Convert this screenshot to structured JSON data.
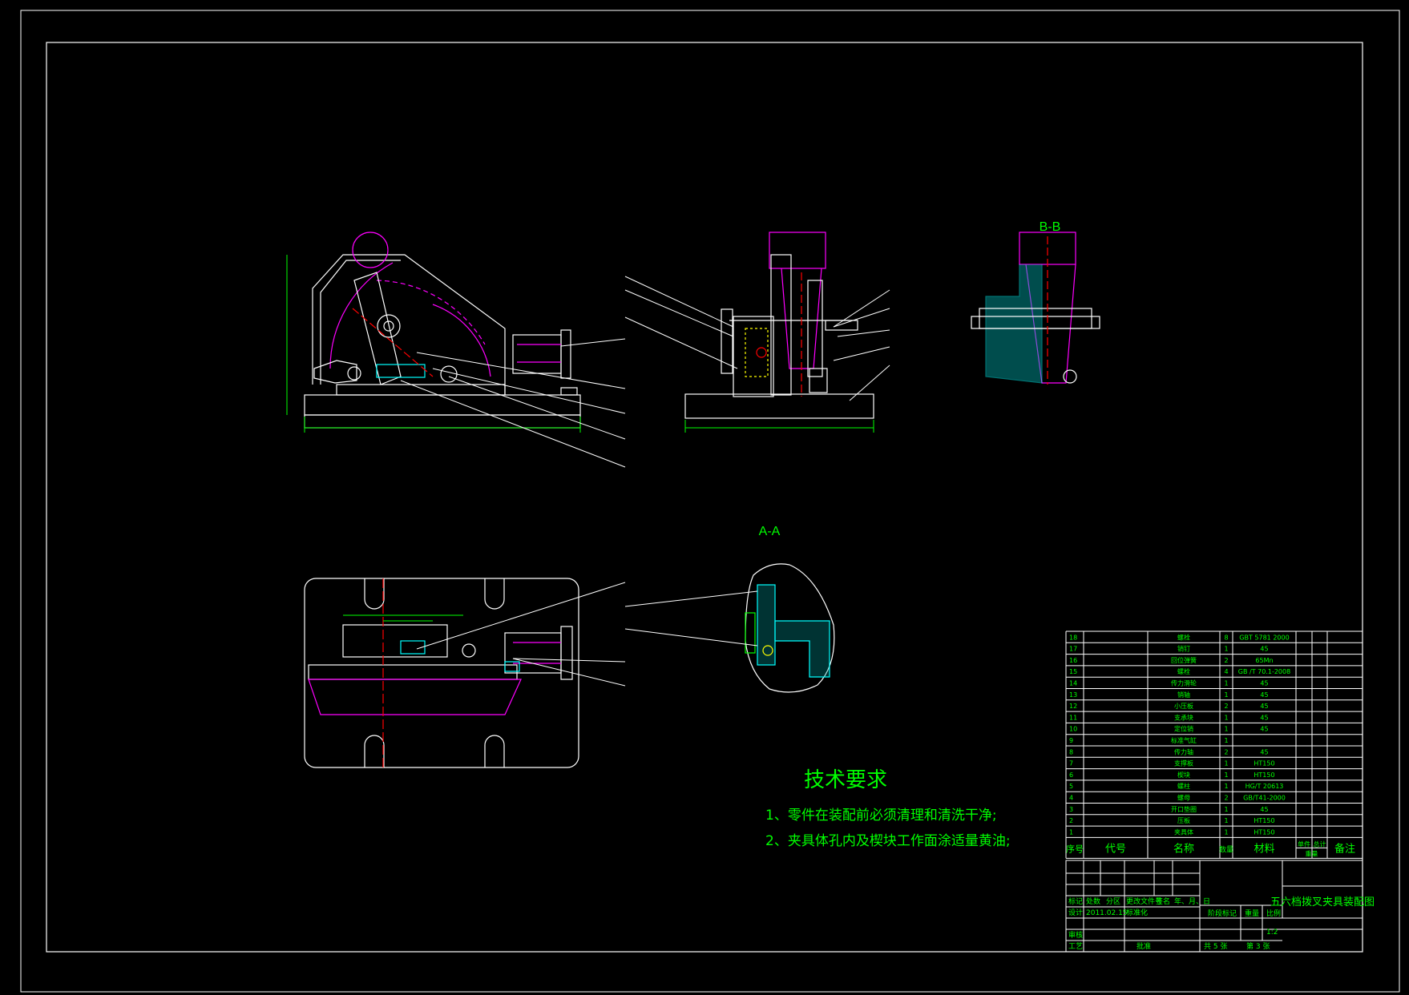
{
  "colors": {
    "background": "#000000",
    "line": "#ffffff",
    "accent": "#00ff00",
    "magenta": "#ff00ff",
    "cyan": "#00ffff",
    "red": "#ff0000",
    "yellow": "#ffff00"
  },
  "views": {
    "section_bb": "B-B",
    "section_aa": "A-A",
    "section_a_mark": "A",
    "section_b_mark": "B"
  },
  "tech": {
    "title": "技术要求",
    "item1": "1、零件在装配前必须清理和清洗干净;",
    "item2": "2、夹具体孔内及楔块工作面涂适量黄油;"
  },
  "bom": {
    "rows": [
      {
        "no": "18",
        "name": "螺栓",
        "qty": "8",
        "mat": "GBT 5781 2000"
      },
      {
        "no": "17",
        "name": "销钉",
        "qty": "1",
        "mat": "45"
      },
      {
        "no": "16",
        "name": "回位弹簧",
        "qty": "2",
        "mat": "65Mn"
      },
      {
        "no": "15",
        "name": "螺栓",
        "qty": "4",
        "mat": "GB /T 70.1-2008"
      },
      {
        "no": "14",
        "name": "传力滑轮",
        "qty": "1",
        "mat": "45"
      },
      {
        "no": "13",
        "name": "销轴",
        "qty": "1",
        "mat": "45"
      },
      {
        "no": "12",
        "name": "小压板",
        "qty": "2",
        "mat": "45"
      },
      {
        "no": "11",
        "name": "支承块",
        "qty": "1",
        "mat": "45"
      },
      {
        "no": "10",
        "name": "定位销",
        "qty": "1",
        "mat": "45"
      },
      {
        "no": "9",
        "name": "标准气缸",
        "qty": "1",
        "mat": ""
      },
      {
        "no": "8",
        "name": "传力轴",
        "qty": "2",
        "mat": "45"
      },
      {
        "no": "7",
        "name": "支撑板",
        "qty": "1",
        "mat": "HT150"
      },
      {
        "no": "6",
        "name": "楔块",
        "qty": "1",
        "mat": "HT150"
      },
      {
        "no": "5",
        "name": "螺柱",
        "qty": "1",
        "mat": "HG/T 20613"
      },
      {
        "no": "4",
        "name": "螺母",
        "qty": "2",
        "mat": "GB/T41-2000"
      },
      {
        "no": "3",
        "name": "开口垫圈",
        "qty": "1",
        "mat": "45"
      },
      {
        "no": "2",
        "name": "压板",
        "qty": "1",
        "mat": "HT150"
      },
      {
        "no": "1",
        "name": "夹具体",
        "qty": "1",
        "mat": "HT150"
      }
    ],
    "header": {
      "no": "序号",
      "code": "代号",
      "name": "名称",
      "qty": "数量",
      "mat": "材料",
      "single": "单件",
      "total": "总计",
      "weight": "重量",
      "remark": "备注"
    }
  },
  "title_block": {
    "drawing_title": "五六档拨叉夹具装配图",
    "mark": "标记",
    "count": "处数",
    "zone": "分区",
    "change_doc": "更改文件号",
    "sign": "签名",
    "date": "年、月、日",
    "design": "设计",
    "design_date": "2011.02.15",
    "standardize": "标准化",
    "check": "审核",
    "process": "工艺",
    "approve": "批准",
    "stage_mark": "阶段标记",
    "weight": "重量",
    "scale": "比例",
    "scale_val": "1:2",
    "sheets_total": "共 5 张",
    "sheet_no": "第 3 张"
  }
}
